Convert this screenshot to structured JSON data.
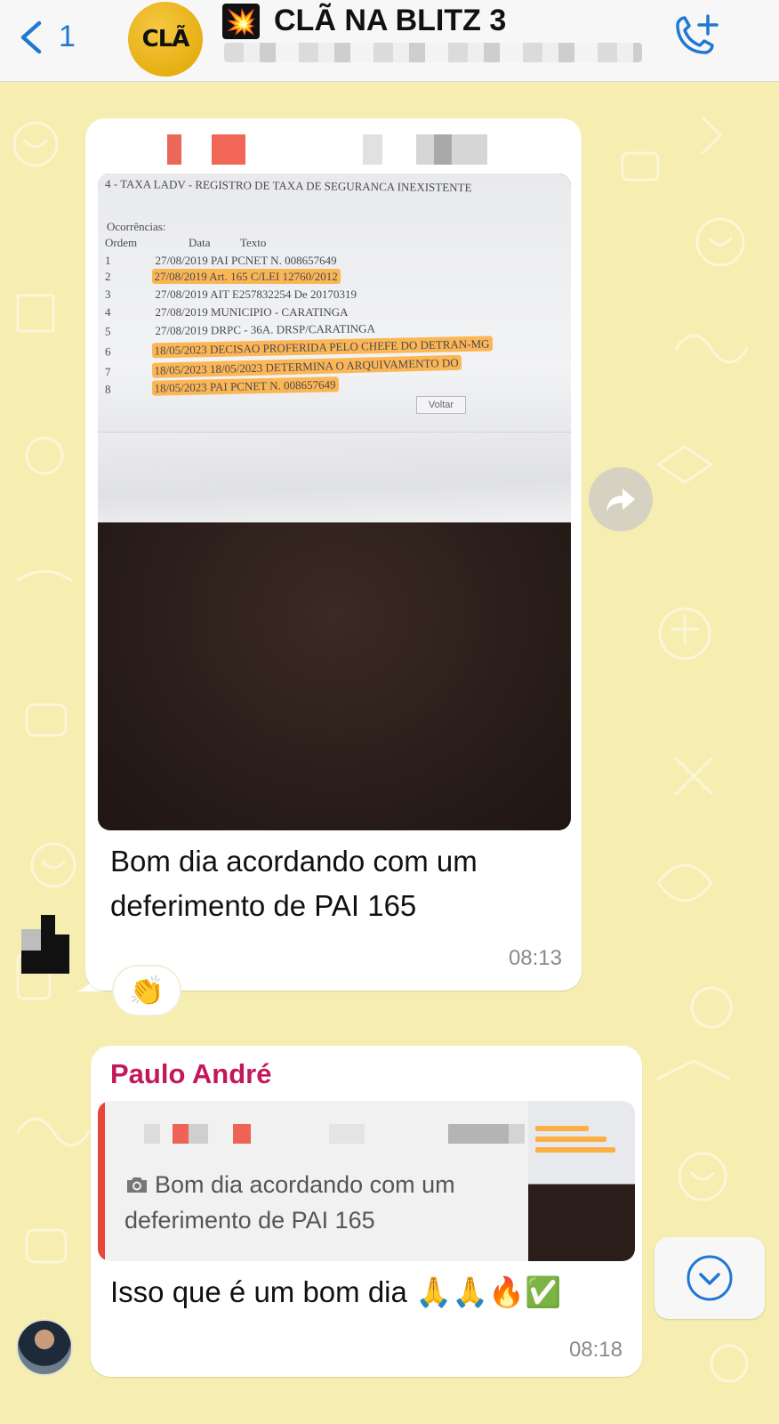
{
  "header": {
    "back_count": "1",
    "logo_text": "CLÃ",
    "group_emoji": "💥",
    "group_title": "CLÃ NA BLITZ 3"
  },
  "message1": {
    "document": {
      "line0": "4 - TAXA LADV - REGISTRO DE TAXA DE SEGURANCA INEXISTENTE",
      "ocorrencias": "Ocorrências:",
      "headers": [
        "Ordem",
        "Data",
        "Texto"
      ],
      "rows": [
        {
          "ordem": "1",
          "data": "27/08/2019",
          "texto": "PAI PCNET N. 008657649"
        },
        {
          "ordem": "2",
          "data": "27/08/2019",
          "texto": "Art. 165 C/LEI 12760/2012"
        },
        {
          "ordem": "3",
          "data": "27/08/2019",
          "texto": "AIT E257832254 De 20170319"
        },
        {
          "ordem": "4",
          "data": "27/08/2019",
          "texto": "MUNICIPIO - CARATINGA"
        },
        {
          "ordem": "5",
          "data": "27/08/2019",
          "texto": "DRPC - 36A. DRSP/CARATINGA"
        },
        {
          "ordem": "6",
          "data": "18/05/2023",
          "texto": "DECISAO PROFERIDA PELO CHEFE DO DETRAN-MG"
        },
        {
          "ordem": "7",
          "data": "18/05/2023",
          "texto": "18/05/2023 DETERMINA O ARQUIVAMENTO DO"
        },
        {
          "ordem": "8",
          "data": "18/05/2023",
          "texto": "PAI PCNET N. 008657649"
        }
      ],
      "button": "Voltar"
    },
    "caption": "Bom dia acordando com um deferimento de PAI 165",
    "time": "08:13",
    "reaction": "👏"
  },
  "message2": {
    "sender": "Paulo André",
    "quoted_text": "Bom dia acordando com um deferimento de PAI 165",
    "text": "Isso que é um bom dia 🙏🙏🔥✅",
    "time": "08:18"
  },
  "colors": {
    "accent": "#1f78d1",
    "sender_name": "#c2185b",
    "quote_bar": "#e8463a",
    "wallpaper": "#f6edb0",
    "highlight": "#ffa528"
  },
  "icons": [
    "back-chevron-icon",
    "add-call-icon",
    "forward-icon",
    "camera-icon",
    "chevron-down-icon"
  ]
}
